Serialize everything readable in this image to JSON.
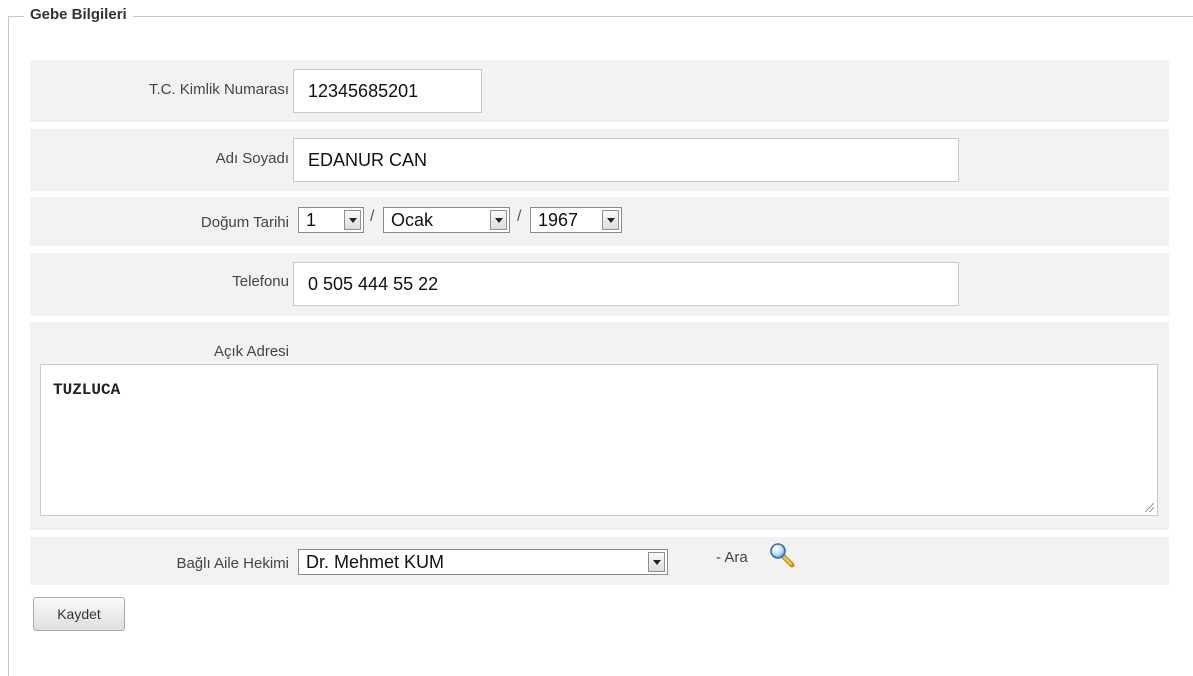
{
  "form": {
    "legend": "Gebe Bilgileri",
    "tc": {
      "label": "T.C. Kimlik Numarası",
      "value": "12345685201"
    },
    "name": {
      "label": "Adı Soyadı",
      "value": "EDANUR CAN"
    },
    "dob": {
      "label": "Doğum Tarihi",
      "day": "1",
      "month": "Ocak",
      "year": "1967",
      "separator": "/"
    },
    "phone": {
      "label": "Telefonu",
      "value": "0 505 444 55 22"
    },
    "address": {
      "label": "Açık Adresi",
      "value": "TUZLUCA"
    },
    "doctor": {
      "label": "Bağlı Aile Hekimi",
      "value": "Dr. Mehmet KUM",
      "search_label": "- Ara"
    },
    "save_label": "Kaydet"
  },
  "icons": {
    "search": "magnifier-icon",
    "dropdown": "chevron-down-icon",
    "resize": "resize-grip-icon"
  }
}
